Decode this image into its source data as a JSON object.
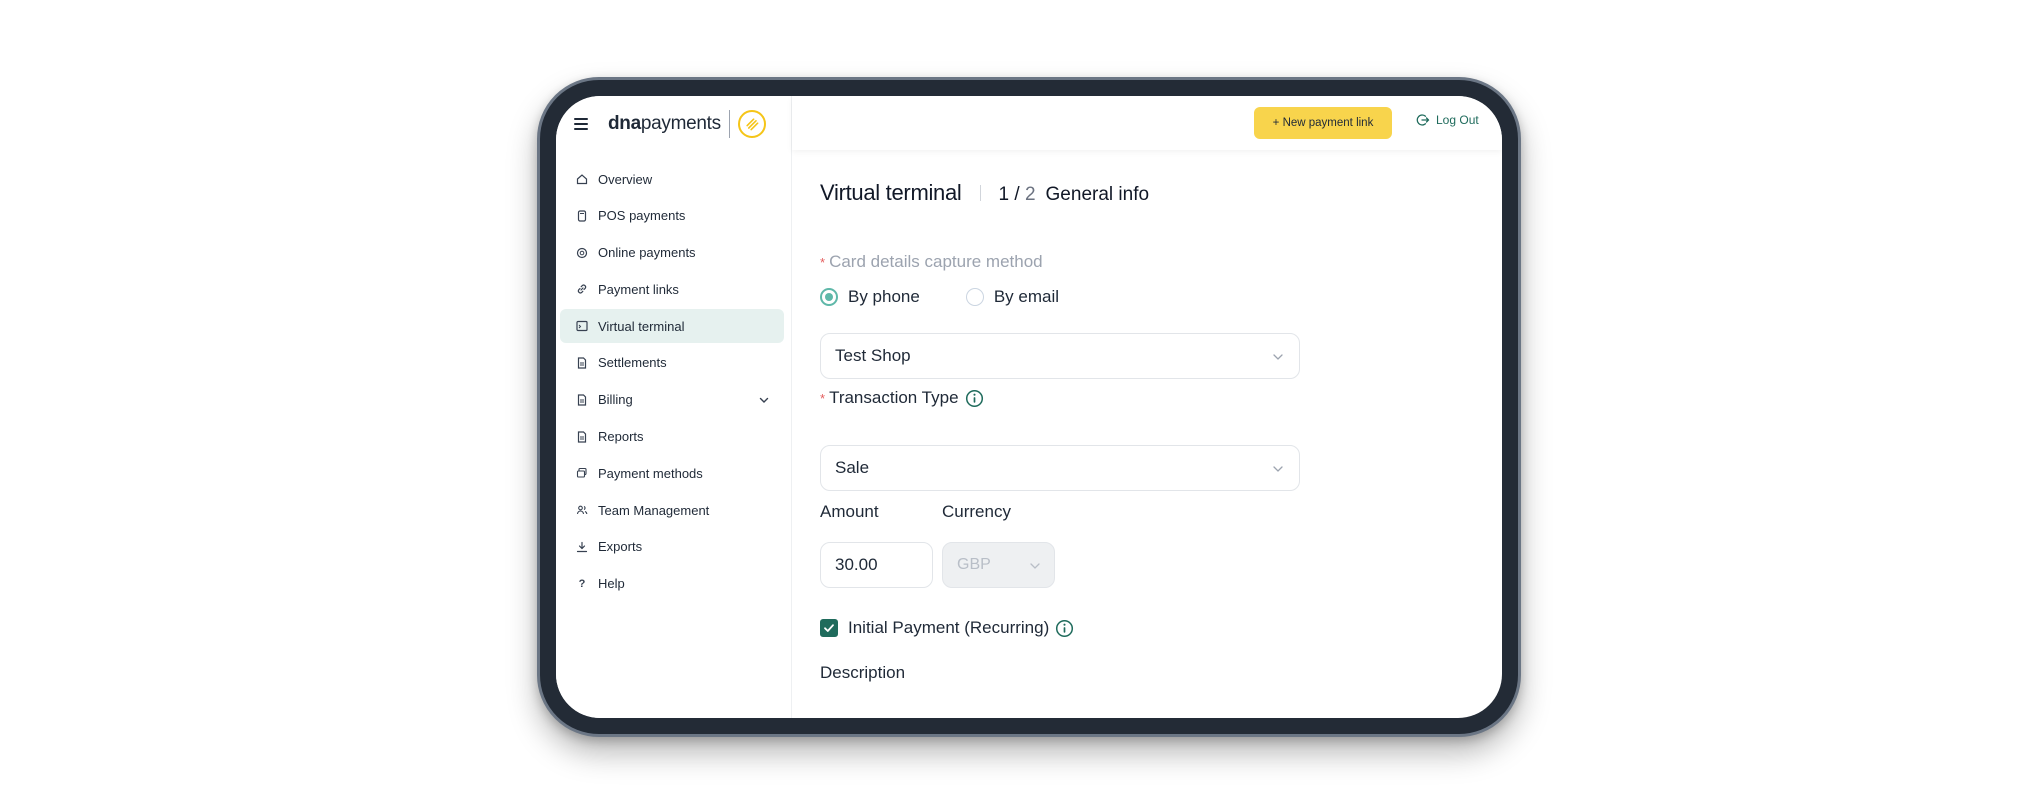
{
  "brand": {
    "logo_bold": "dna",
    "logo_regular": "payments"
  },
  "sidebar": {
    "items": [
      {
        "label": "Overview",
        "icon": "home-icon"
      },
      {
        "label": "POS payments",
        "icon": "pos-terminal-icon"
      },
      {
        "label": "Online payments",
        "icon": "globe-icon"
      },
      {
        "label": "Payment links",
        "icon": "link-icon"
      },
      {
        "label": "Virtual terminal",
        "icon": "terminal-icon",
        "active": true
      },
      {
        "label": "Settlements",
        "icon": "document-icon"
      },
      {
        "label": "Billing",
        "icon": "document-icon",
        "expandable": true
      },
      {
        "label": "Reports",
        "icon": "document-icon"
      },
      {
        "label": "Payment methods",
        "icon": "cards-icon"
      },
      {
        "label": "Team Management",
        "icon": "team-icon"
      },
      {
        "label": "Exports",
        "icon": "download-icon"
      },
      {
        "label": "Help",
        "icon": "question-icon"
      }
    ]
  },
  "topbar": {
    "new_link_label": "+ New payment link",
    "logout_label": "Log Out"
  },
  "main": {
    "title": "Virtual terminal",
    "step_current": "1",
    "step_sep": " / ",
    "step_total": "2",
    "step_name": "General info",
    "capture_label": "Card details capture method",
    "radio_phone": "By phone",
    "radio_email": "By email",
    "radio_selected": "By phone",
    "shop_value": "Test Shop",
    "transaction_label": "Transaction Type",
    "transaction_value": "Sale",
    "amount_label": "Amount",
    "amount_value": "30.00",
    "currency_label": "Currency",
    "currency_value": "GBP",
    "initial_payment_label": "Initial Payment (Recurring)",
    "initial_payment_checked": true,
    "description_label": "Description"
  },
  "colors": {
    "accent_yellow": "#f8d44c",
    "accent_teal": "#1f6b5c",
    "radio_teal": "#5fb8a9",
    "active_nav_bg": "#e6f1ef",
    "device_frame": "#232b36",
    "required_star": "#e45d5d"
  }
}
